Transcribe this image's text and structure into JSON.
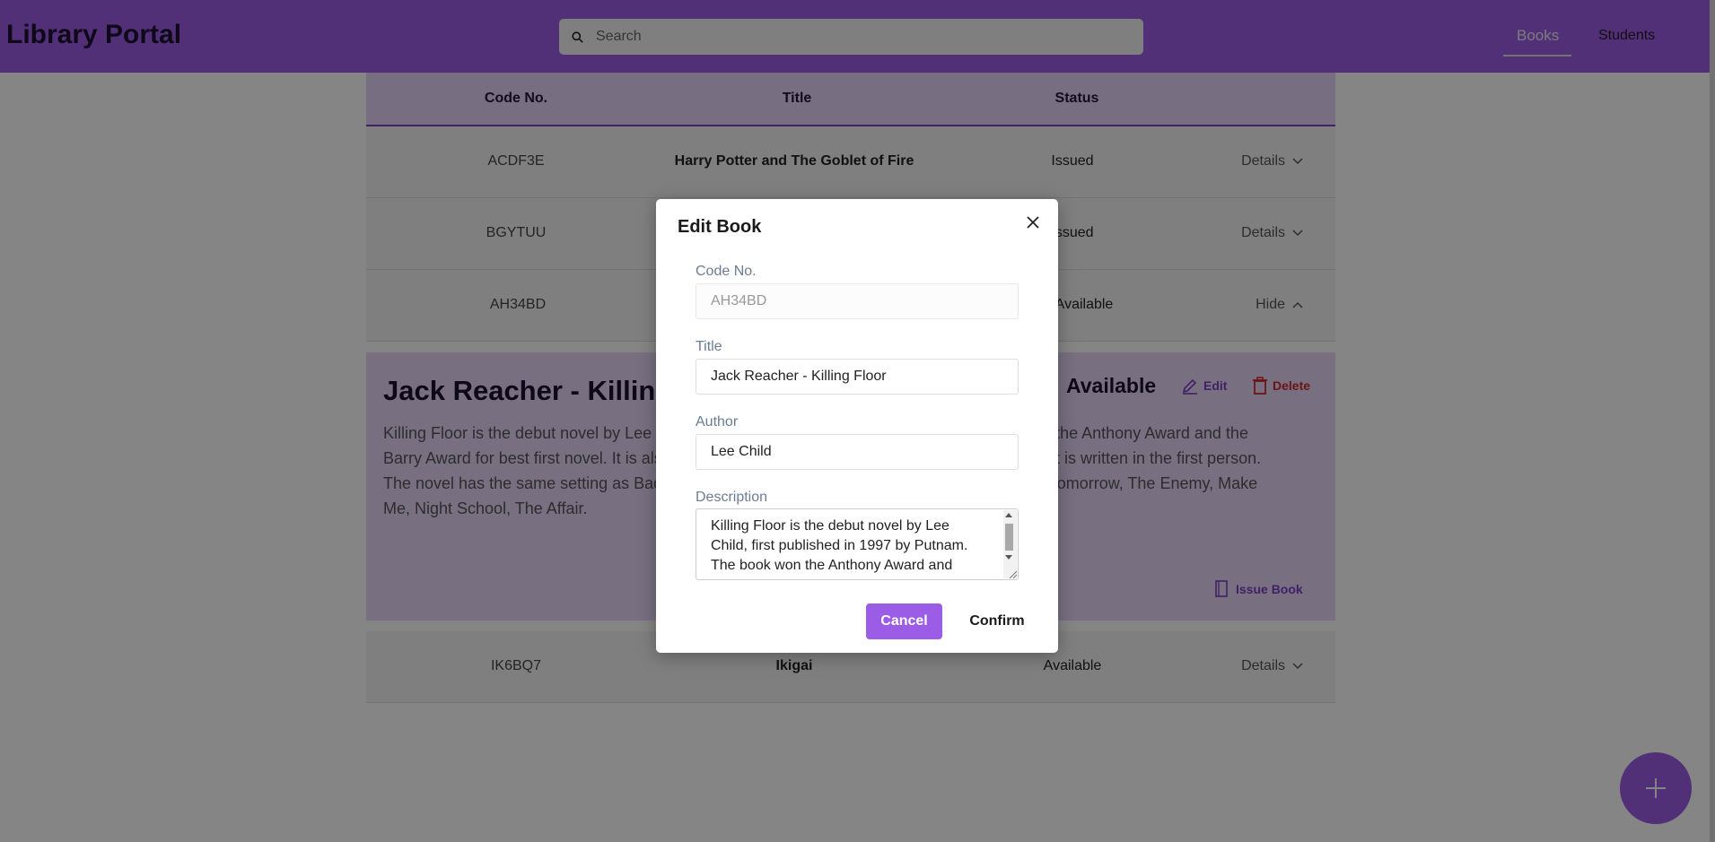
{
  "header": {
    "logo": "Library Portal",
    "search_placeholder": "Search",
    "nav": {
      "books": "Books",
      "students": "Students"
    }
  },
  "table": {
    "columns": [
      "Code No.",
      "Title",
      "Status"
    ],
    "rows": [
      {
        "code": "ACDF3E",
        "title": "Harry Potter and The Goblet of Fire",
        "status": "Issued",
        "action": "Details"
      },
      {
        "code": "BGYTUU",
        "title": "",
        "status": "Issued",
        "action": "Details"
      },
      {
        "code": "AH34BD",
        "title": "",
        "status": "Available",
        "action": "Hide"
      },
      {
        "code": "IK6BQ7",
        "title": "Ikigai",
        "status": "Available",
        "action": "Details"
      }
    ]
  },
  "details": {
    "title": "Jack Reacher - Killing Floor",
    "description": "Killing Floor is the debut novel by Lee Child, first published in 1997 by Putnam. The book won the Anthony Award and the Barry Award for best first novel. It is also the first book to feature the character Jack Reacher. It is written in the first person. The novel has the same setting as Bad Luck and Trouble, The Hard Way, Without Fail, Gone Tomorrow, The Enemy, Make Me, Night School, The Affair.",
    "status": "Available",
    "edit_label": "Edit",
    "delete_label": "Delete",
    "issue_label": "Issue Book"
  },
  "modal": {
    "title": "Edit Book",
    "code_label": "Code No.",
    "code_value": "AH34BD",
    "title_label": "Title",
    "title_value": "Jack Reacher - Killing Floor",
    "author_label": "Author",
    "author_value": "Lee Child",
    "description_label": "Description",
    "description_value": "Killing Floor is the debut novel by Lee Child, first published in 1997 by Putnam. The book won the Anthony Award and",
    "cancel_label": "Cancel",
    "confirm_label": "Confirm"
  },
  "colors": {
    "brand": "#9b5de5",
    "danger": "#cf2a2a"
  }
}
